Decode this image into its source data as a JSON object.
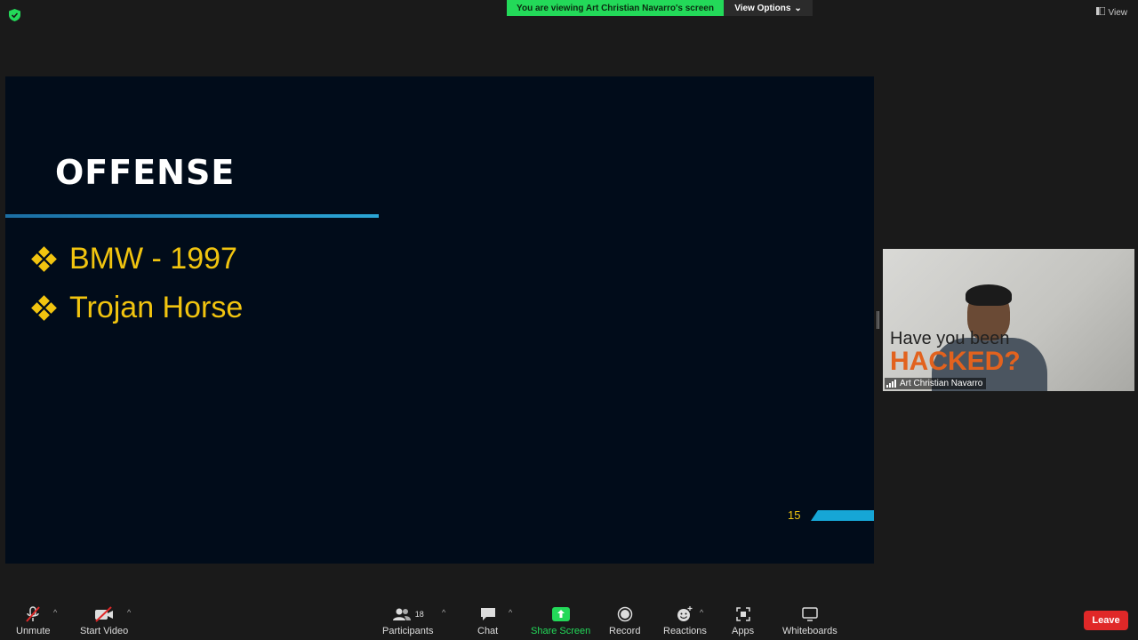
{
  "banner": {
    "viewing_text": "You are viewing Art Christian Navarro's screen",
    "view_options": "View Options"
  },
  "topright": {
    "view_label": "View"
  },
  "slide": {
    "title": "OFFENSE",
    "bullets": [
      "BMW - 1997",
      "Trojan Horse"
    ],
    "page_number": "15"
  },
  "video": {
    "overlay_line1": "Have you been",
    "overlay_line2": "HACKED?",
    "participant_name": "Art Christian Navarro"
  },
  "toolbar": {
    "unmute": "Unmute",
    "start_video": "Start Video",
    "participants": "Participants",
    "participants_count": "18",
    "chat": "Chat",
    "share_screen": "Share Screen",
    "record": "Record",
    "reactions": "Reactions",
    "apps": "Apps",
    "whiteboards": "Whiteboards",
    "leave": "Leave"
  },
  "colors": {
    "banner_green": "#23d959",
    "slide_bg": "#010c1a",
    "bullet_yellow": "#f1c40f",
    "accent_blue": "#16a6d6",
    "leave_red": "#e02828"
  }
}
